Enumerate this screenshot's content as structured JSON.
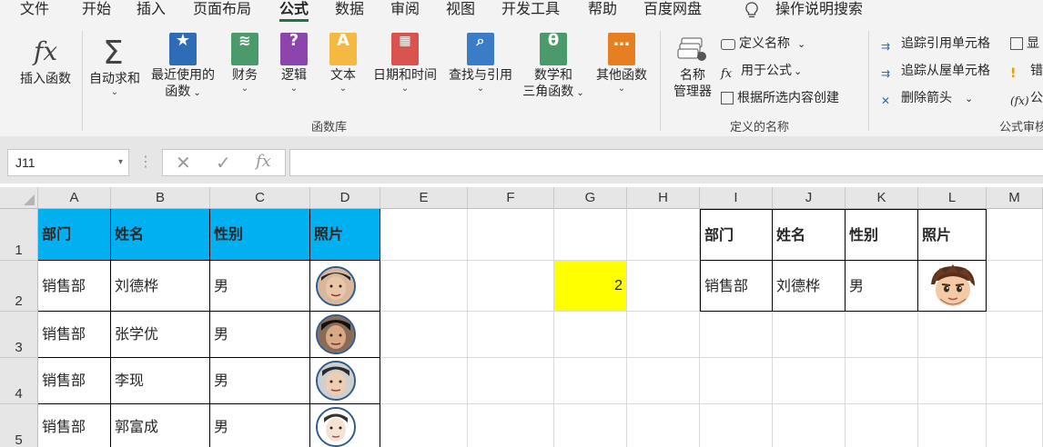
{
  "menu": {
    "items": [
      "文件",
      "开始",
      "插入",
      "页面布局",
      "公式",
      "数据",
      "审阅",
      "视图",
      "开发工具",
      "帮助",
      "百度网盘"
    ],
    "active": "公式",
    "search_label": "操作说明搜索"
  },
  "ribbon": {
    "function_library": {
      "insert_function": "插入函数",
      "autosum": "自动求和",
      "recent_line1": "最近使用的",
      "recent_line2": "函数",
      "financial": "财务",
      "logical": "逻辑",
      "text": "文本",
      "datetime": "日期和时间",
      "lookup": "查找与引用",
      "math_line1": "数学和",
      "math_line2": "三角函数",
      "more": "其他函数",
      "group_label": "函数库",
      "text_tile_glyph": "A",
      "logical_tile_glyph": "?",
      "math_tile_glyph": "θ"
    },
    "defined_names": {
      "name_manager_line1": "名称",
      "name_manager_line2": "管理器",
      "define_name": "定义名称",
      "use_in_formula": "用于公式",
      "create_from_selection": "根据所选内容创建",
      "group_label": "定义的名称"
    },
    "formula_auditing": {
      "trace_precedents": "追踪引用单元格",
      "trace_dependents": "追踪从屋单元格",
      "remove_arrows": "删除箭头",
      "show_partial": "显",
      "error_partial": "错",
      "evaluate_partial": "公",
      "group_label": "公式审核"
    }
  },
  "formula_bar": {
    "name_box": "J11",
    "formula": ""
  },
  "sheet": {
    "columns": [
      "A",
      "B",
      "C",
      "D",
      "E",
      "F",
      "G",
      "H",
      "I",
      "J",
      "K",
      "L",
      "M"
    ],
    "rows": [
      "1",
      "2",
      "3",
      "4",
      "5"
    ],
    "left_table": {
      "headers": [
        "部门",
        "姓名",
        "性别",
        "照片"
      ],
      "rows": [
        [
          "销售部",
          "刘德桦",
          "男"
        ],
        [
          "销售部",
          "张学优",
          "男"
        ],
        [
          "销售部",
          "李现",
          "男"
        ],
        [
          "销售部",
          "郭富成",
          "男"
        ]
      ]
    },
    "g2_value": "2",
    "right_table": {
      "headers": [
        "部门",
        "姓名",
        "性别",
        "照片"
      ],
      "row": [
        "销售部",
        "刘德桦",
        "男"
      ]
    }
  },
  "colors": {
    "header_fill": "#00b0f0",
    "highlight_fill": "#ffff00",
    "excel_green": "#217346"
  }
}
